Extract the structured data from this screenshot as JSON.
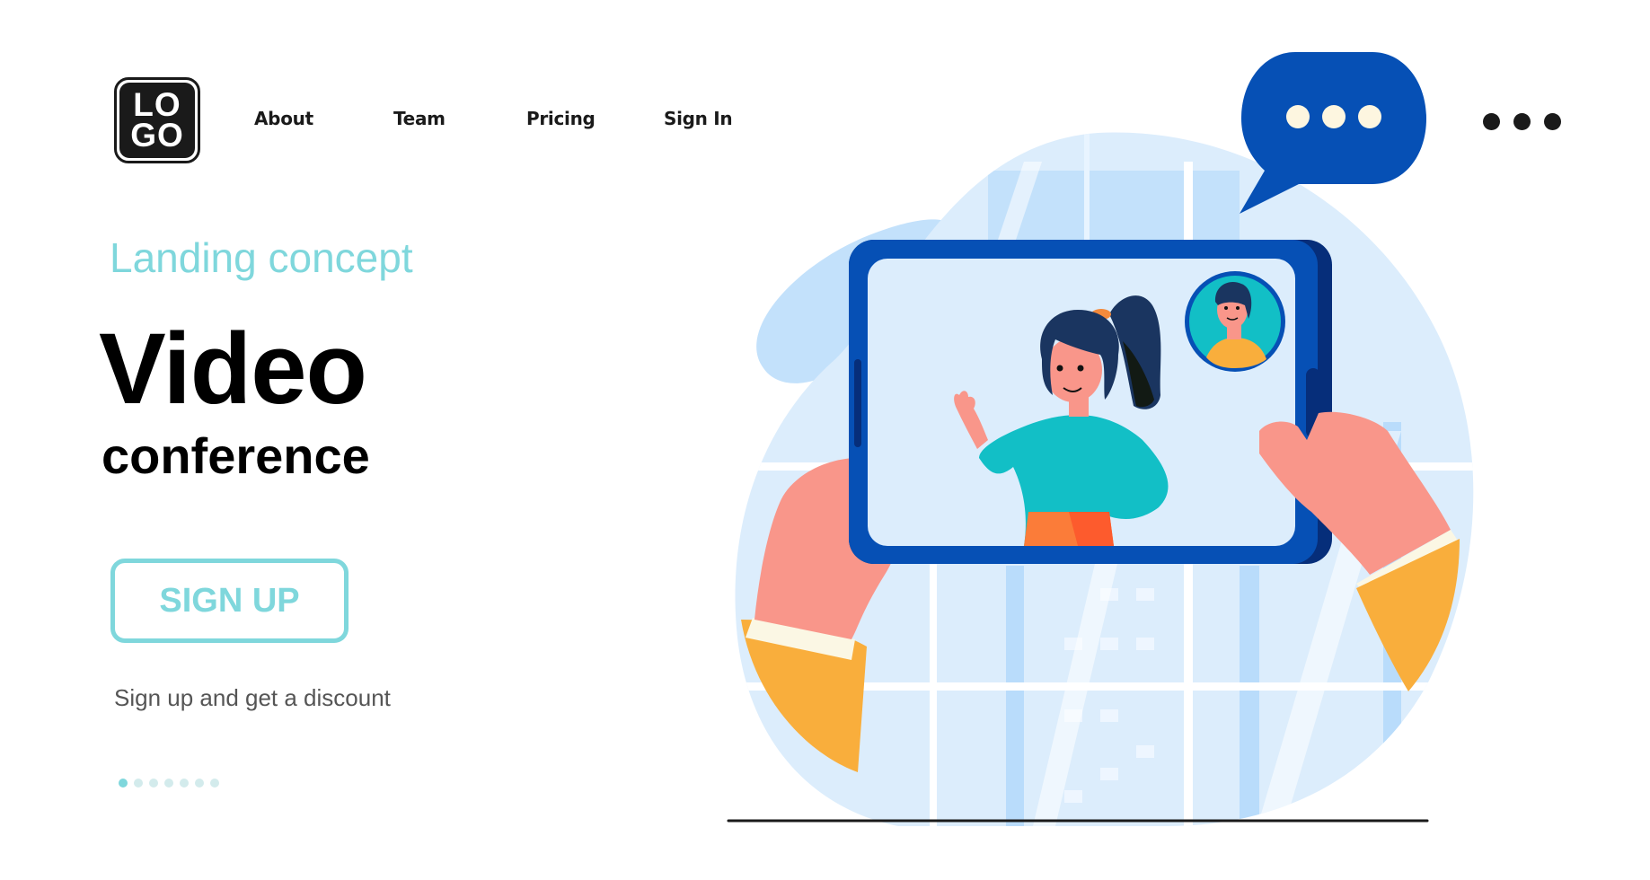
{
  "header": {
    "logo_lines": [
      "LO",
      "GO"
    ],
    "nav": [
      {
        "label": "About"
      },
      {
        "label": "Team"
      },
      {
        "label": "Pricing"
      },
      {
        "label": "Sign In"
      }
    ],
    "more_icon": "more-horizontal-icon"
  },
  "hero": {
    "kicker": "Landing concept",
    "title": "Video",
    "subtitle": "conference",
    "cta_label": "SIGN UP",
    "caption": "Sign up and get a discount"
  },
  "pagination": {
    "total": 7,
    "active_index": 0
  },
  "illustration": {
    "subject": "Hands holding a tablet showing a video call with a waving woman and a small picture-in-picture of a man",
    "chat_bubble_icon": "chat-bubble-typing-icon"
  },
  "colors": {
    "accent": "#7fd7dc",
    "text": "#000000",
    "caption": "#555555",
    "tablet": "#0650b5",
    "tablet_dark": "#062e7a",
    "screen": "#dcedfc",
    "skin": "#f9968a",
    "sleeve": "#f9ae3c",
    "teal_shirt": "#12bfc6"
  }
}
